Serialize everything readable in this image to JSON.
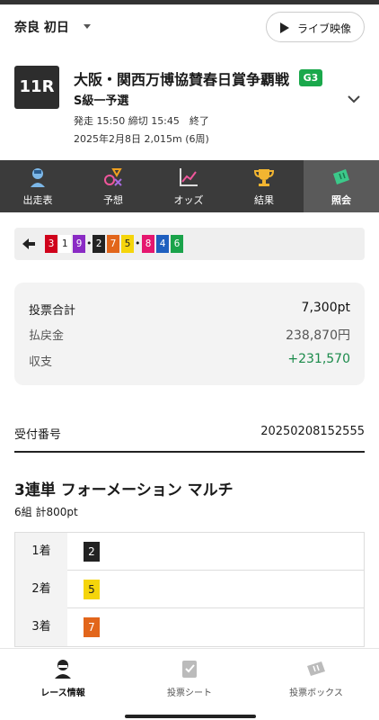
{
  "header": {
    "venue": "奈良 初日",
    "live_label": "ライブ映像"
  },
  "race": {
    "number": "11R",
    "title": "大阪・関西万博協賛春日賞争覇戦",
    "grade": "G3",
    "subtitle": "S級一予選",
    "times": "発走 15:50 締切 15:45　終了",
    "date": "2025年2月8日 2,015m (6周)"
  },
  "tabs": [
    {
      "label": "出走表",
      "icon": "cyclist-icon"
    },
    {
      "label": "予想",
      "icon": "prediction-icon"
    },
    {
      "label": "オッズ",
      "icon": "chart-icon"
    },
    {
      "label": "結果",
      "icon": "trophy-icon"
    },
    {
      "label": "照会",
      "icon": "ticket-icon"
    }
  ],
  "combo": {
    "numbers": [
      "3",
      "1",
      "9",
      "2",
      "7",
      "5",
      "8",
      "4",
      "6"
    ],
    "colors": {
      "1": "#ffffff",
      "2": "#222222",
      "3": "#d0021b",
      "4": "#1f5fbf",
      "5": "#f5d50b",
      "6": "#1aa34a",
      "7": "#e2661b",
      "8": "#e5176f",
      "9": "#8a2bc4"
    }
  },
  "summary": {
    "total_label": "投票合計",
    "total_value": "7,300pt",
    "payout_label": "払戻金",
    "payout_value": "238,870円",
    "balance_label": "収支",
    "balance_value": "+231,570",
    "balance_color": "#1a8a4a"
  },
  "receipt": {
    "label": "受付番号",
    "value": "20250208152555"
  },
  "bet": {
    "title": "3連単 フォーメーション マルチ",
    "subtitle": "6組 計800pt",
    "places": [
      {
        "label": "1着",
        "number": "2"
      },
      {
        "label": "2着",
        "number": "5"
      },
      {
        "label": "3着",
        "number": "7"
      }
    ]
  },
  "bottom_nav": [
    {
      "label": "レース情報",
      "icon": "racer-icon"
    },
    {
      "label": "投票シート",
      "icon": "vote-sheet-icon"
    },
    {
      "label": "投票ボックス",
      "icon": "vote-box-icon"
    }
  ]
}
